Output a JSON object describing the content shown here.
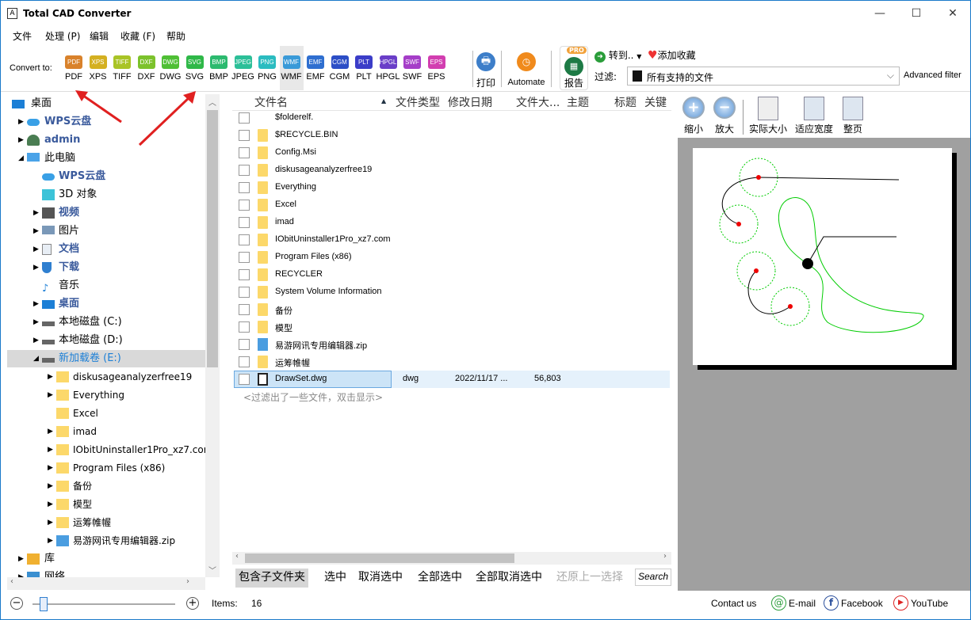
{
  "window": {
    "title": "Total CAD Converter",
    "icon": "A",
    "minimize": "—",
    "maximize": "☐",
    "close": "✕"
  },
  "menu": [
    "文件",
    "处理 (P)",
    "编辑",
    "收藏 (F)",
    "帮助"
  ],
  "toolbar": {
    "convert_label": "Convert to:",
    "formats": [
      {
        "label": "PDF",
        "color": "#d9822b"
      },
      {
        "label": "XPS",
        "color": "#d4b021"
      },
      {
        "label": "TIFF",
        "color": "#a9c426"
      },
      {
        "label": "DXF",
        "color": "#7cc22c"
      },
      {
        "label": "DWG",
        "color": "#4fbf35"
      },
      {
        "label": "SVG",
        "color": "#2fb848"
      },
      {
        "label": "BMP",
        "color": "#2cba6f"
      },
      {
        "label": "JPEG",
        "color": "#2cbf98"
      },
      {
        "label": "PNG",
        "color": "#2bbcc0"
      },
      {
        "label": "WMF",
        "color": "#3a9ad8"
      },
      {
        "label": "EMF",
        "color": "#2f6fd0"
      },
      {
        "label": "CGM",
        "color": "#2c4ec6"
      },
      {
        "label": "PLT",
        "color": "#3b3dc8"
      },
      {
        "label": "HPGL",
        "color": "#6a3ec8"
      },
      {
        "label": "SWF",
        "color": "#a53ec8"
      },
      {
        "label": "EPS",
        "color": "#d23eb0"
      }
    ],
    "print": "打印",
    "automate": "Automate",
    "report": "报告",
    "pro_badge": "PRO",
    "goto": "转到..",
    "favorite": "添加收藏",
    "filter_label": "过滤:",
    "filter_value": "所有支持的文件",
    "advanced_filter": "Advanced filter"
  },
  "tree": [
    {
      "label": "桌面",
      "level": 0,
      "exp": "",
      "icon": "desktop-icon",
      "style": ""
    },
    {
      "label": "WPS云盘",
      "level": 1,
      "exp": "▶",
      "icon": "cloud-icon",
      "style": "bold"
    },
    {
      "label": "admin",
      "level": 1,
      "exp": "▶",
      "icon": "user-icon",
      "style": "bold"
    },
    {
      "label": "此电脑",
      "level": 1,
      "exp": "◢",
      "icon": "computer-icon",
      "style": ""
    },
    {
      "label": "WPS云盘",
      "level": 2,
      "exp": "",
      "icon": "cloud-icon",
      "style": "bold"
    },
    {
      "label": "3D 对象",
      "level": 2,
      "exp": "",
      "icon": "cube-icon",
      "style": ""
    },
    {
      "label": "视频",
      "level": 2,
      "exp": "▶",
      "icon": "video-icon",
      "style": "bold"
    },
    {
      "label": "图片",
      "level": 2,
      "exp": "▶",
      "icon": "picture-icon",
      "style": ""
    },
    {
      "label": "文档",
      "level": 2,
      "exp": "▶",
      "icon": "document-icon",
      "style": "bold"
    },
    {
      "label": "下载",
      "level": 2,
      "exp": "▶",
      "icon": "download-icon",
      "style": "bold"
    },
    {
      "label": "音乐",
      "level": 2,
      "exp": "",
      "icon": "music-icon",
      "style": ""
    },
    {
      "label": "桌面",
      "level": 2,
      "exp": "▶",
      "icon": "desktop-icon",
      "style": "bold"
    },
    {
      "label": "本地磁盘 (C:)",
      "level": 2,
      "exp": "▶",
      "icon": "drive-icon",
      "style": ""
    },
    {
      "label": "本地磁盘 (D:)",
      "level": 2,
      "exp": "▶",
      "icon": "drive-icon",
      "style": ""
    },
    {
      "label": "新加载卷 (E:)",
      "level": 2,
      "exp": "◢",
      "icon": "drive-icon",
      "style": "sel"
    },
    {
      "label": "diskusageanalyzerfree19",
      "level": 3,
      "exp": "▶",
      "icon": "folder-icon",
      "style": ""
    },
    {
      "label": "Everything",
      "level": 3,
      "exp": "▶",
      "icon": "folder-icon",
      "style": ""
    },
    {
      "label": "Excel",
      "level": 3,
      "exp": "",
      "icon": "folder-icon",
      "style": ""
    },
    {
      "label": "imad",
      "level": 3,
      "exp": "▶",
      "icon": "folder-icon",
      "style": ""
    },
    {
      "label": "IObitUninstaller1Pro_xz7.com",
      "level": 3,
      "exp": "▶",
      "icon": "folder-icon",
      "style": ""
    },
    {
      "label": "Program Files (x86)",
      "level": 3,
      "exp": "▶",
      "icon": "folder-icon",
      "style": ""
    },
    {
      "label": "备份",
      "level": 3,
      "exp": "▶",
      "icon": "folder-icon",
      "style": ""
    },
    {
      "label": "模型",
      "level": 3,
      "exp": "▶",
      "icon": "folder-icon",
      "style": ""
    },
    {
      "label": "运筹帷幄",
      "level": 3,
      "exp": "▶",
      "icon": "folder-icon",
      "style": ""
    },
    {
      "label": "易游网讯专用编辑器.zip",
      "level": 3,
      "exp": "▶",
      "icon": "zip-icon",
      "style": ""
    },
    {
      "label": "库",
      "level": 1,
      "exp": "▶",
      "icon": "library-icon",
      "style": ""
    },
    {
      "label": "网络",
      "level": 1,
      "exp": "▶",
      "icon": "network-icon",
      "style": ""
    }
  ],
  "filelist": {
    "columns": [
      "文件名",
      "文件类型",
      "修改日期",
      "文件大...",
      "主题",
      "标题",
      "关键"
    ],
    "rows": [
      {
        "name": "$folderelf.",
        "type": "",
        "date": "",
        "size": "",
        "icon": "none"
      },
      {
        "name": "$RECYCLE.BIN",
        "type": "",
        "date": "",
        "size": "",
        "icon": "folder"
      },
      {
        "name": "Config.Msi",
        "type": "",
        "date": "",
        "size": "",
        "icon": "folder"
      },
      {
        "name": "diskusageanalyzerfree19",
        "type": "",
        "date": "",
        "size": "",
        "icon": "folder"
      },
      {
        "name": "Everything",
        "type": "",
        "date": "",
        "size": "",
        "icon": "folder"
      },
      {
        "name": "Excel",
        "type": "",
        "date": "",
        "size": "",
        "icon": "folder"
      },
      {
        "name": "imad",
        "type": "",
        "date": "",
        "size": "",
        "icon": "folder"
      },
      {
        "name": "IObitUninstaller1Pro_xz7.com",
        "type": "",
        "date": "",
        "size": "",
        "icon": "folder"
      },
      {
        "name": "Program Files (x86)",
        "type": "",
        "date": "",
        "size": "",
        "icon": "folder"
      },
      {
        "name": "RECYCLER",
        "type": "",
        "date": "",
        "size": "",
        "icon": "folder"
      },
      {
        "name": "System Volume Information",
        "type": "",
        "date": "",
        "size": "",
        "icon": "folder"
      },
      {
        "name": "备份",
        "type": "",
        "date": "",
        "size": "",
        "icon": "folder"
      },
      {
        "name": "模型",
        "type": "",
        "date": "",
        "size": "",
        "icon": "folder"
      },
      {
        "name": "易游网讯专用编辑器.zip",
        "type": "",
        "date": "",
        "size": "",
        "icon": "zip"
      },
      {
        "name": "运筹帷幄",
        "type": "",
        "date": "",
        "size": "",
        "icon": "folder"
      },
      {
        "name": "DrawSet.dwg",
        "type": "dwg",
        "date": "2022/11/17 ...",
        "size": "56,803",
        "icon": "file"
      }
    ],
    "filtered_note": "<过滤出了一些文件，双击显示>",
    "buttons": [
      "包含子文件夹",
      "选中",
      "取消选中",
      "全部选中",
      "全部取消选中",
      "还原上一选择"
    ],
    "search": "Search"
  },
  "preview": {
    "buttons": [
      "缩小",
      "放大",
      "实际大小",
      "适应宽度",
      "整页"
    ]
  },
  "status": {
    "items_label": "Items:",
    "items_count": "16",
    "contact": "Contact us",
    "email": "E-mail",
    "facebook": "Facebook",
    "youtube": "YouTube",
    "zoom_level": 0.05
  }
}
